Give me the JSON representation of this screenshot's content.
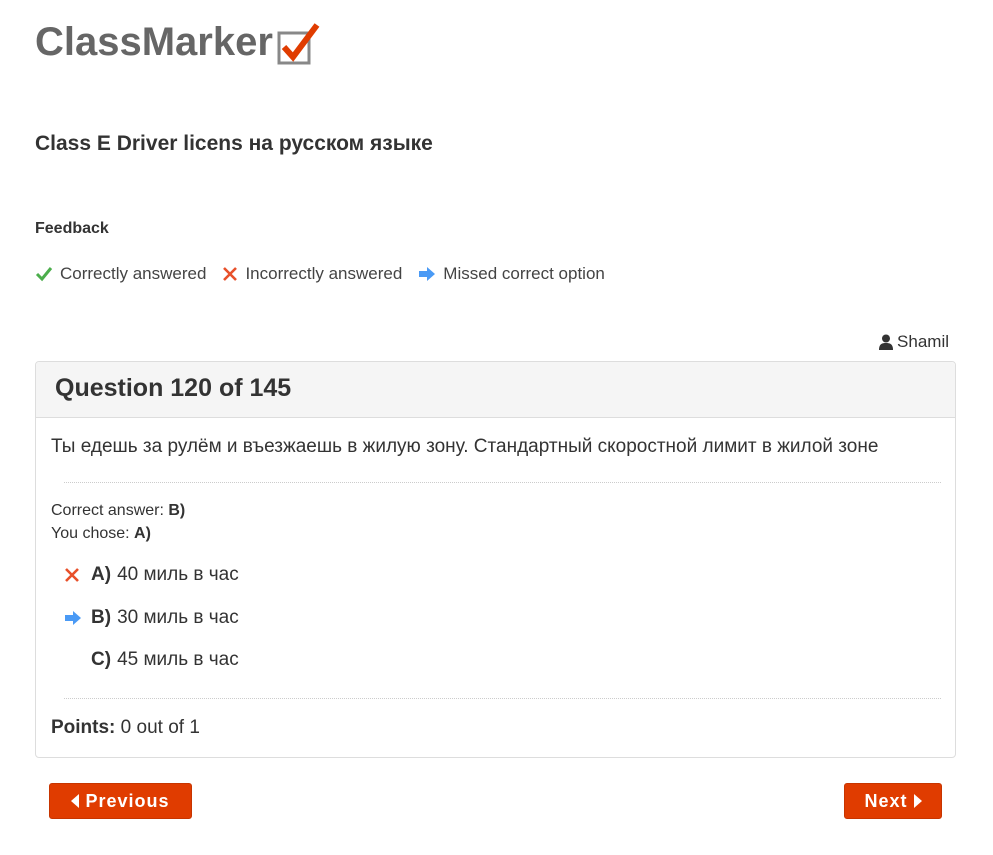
{
  "logo": {
    "text": "ClassMarker"
  },
  "quiz_title": "Class E Driver licens на русском языке",
  "feedback": {
    "heading": "Feedback",
    "legend": {
      "correct": "Correctly answered",
      "incorrect": "Incorrectly answered",
      "missed": "Missed correct option"
    }
  },
  "user": {
    "name": "Shamil"
  },
  "question": {
    "header": "Question 120 of 145",
    "text": "Ты едешь за рулём и въезжаешь в жилую зону. Стандартный скоростной лимит в жилой зоне",
    "correct_answer_label": "Correct answer:",
    "correct_answer_value": "B)",
    "you_chose_label": "You chose:",
    "you_chose_value": "A)",
    "options": [
      {
        "letter": "A)",
        "text": "40 миль в час",
        "mark": "incorrect"
      },
      {
        "letter": "B)",
        "text": "30 миль в час",
        "mark": "missed"
      },
      {
        "letter": "C)",
        "text": "45 миль в час",
        "mark": "none"
      }
    ],
    "points_label": "Points:",
    "points_value": "0 out of 1"
  },
  "nav": {
    "previous": "Previous",
    "next": "Next"
  },
  "colors": {
    "correct": "#4cae4c",
    "incorrect": "#e8502a",
    "missed": "#4a9af5",
    "button": "#e03c00",
    "logo_check": "#e03c00"
  }
}
